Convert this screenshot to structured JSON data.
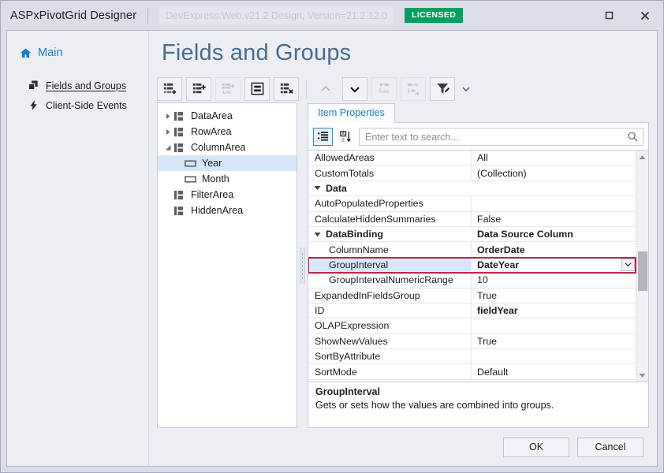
{
  "titlebar": {
    "app_title": "ASPxPivotGrid Designer",
    "assembly": "DevExpress.Web.v21.2.Design, Version=21.2.12.0",
    "license_badge": "LICENSED",
    "maximize_icon": "maximize-icon",
    "close_icon": "close-icon"
  },
  "sidebar": {
    "group_label": "Main",
    "home_icon": "home-icon",
    "items": [
      {
        "label": "Fields and Groups",
        "icon": "layers-icon",
        "active": true
      },
      {
        "label": "Client-Side Events",
        "icon": "lightning-icon",
        "active": false
      }
    ]
  },
  "page": {
    "title": "Fields and Groups"
  },
  "toolbar": {
    "buttons": [
      {
        "name": "add-field-button",
        "icon": "field-add-icon",
        "disabled": false
      },
      {
        "name": "add-group-button",
        "icon": "group-add-icon",
        "disabled": false
      },
      {
        "name": "add-child-button",
        "icon": "child-add-icon",
        "disabled": true
      },
      {
        "name": "edit-item-button",
        "icon": "edit-box-icon",
        "disabled": false
      },
      {
        "name": "delete-item-button",
        "icon": "field-delete-icon",
        "disabled": false
      },
      {
        "name": "move-up-button",
        "icon": "chevron-up-icon",
        "disabled": true
      },
      {
        "name": "move-down-button",
        "icon": "chevron-down-icon",
        "disabled": false
      },
      {
        "name": "move-out-button",
        "icon": "outdent-icon",
        "disabled": true
      },
      {
        "name": "move-in-button",
        "icon": "indent-icon",
        "disabled": true
      },
      {
        "name": "customize-button",
        "icon": "funnel-icon",
        "disabled": false
      }
    ],
    "split_arrow_icon": "caret-down-icon"
  },
  "tree": {
    "nodes": [
      {
        "label": "DataArea",
        "icon": "area-icon",
        "indent": 0,
        "expander": "collapsed",
        "selected": false
      },
      {
        "label": "RowArea",
        "icon": "area-icon",
        "indent": 0,
        "expander": "collapsed",
        "selected": false
      },
      {
        "label": "ColumnArea",
        "icon": "area-icon",
        "indent": 0,
        "expander": "expanded",
        "selected": false
      },
      {
        "label": "Year",
        "icon": "field-icon",
        "indent": 1,
        "expander": "none",
        "selected": true
      },
      {
        "label": "Month",
        "icon": "field-icon",
        "indent": 1,
        "expander": "none",
        "selected": false
      },
      {
        "label": "FilterArea",
        "icon": "area-icon",
        "indent": 0,
        "expander": "none",
        "selected": false
      },
      {
        "label": "HiddenArea",
        "icon": "area-icon",
        "indent": 0,
        "expander": "none",
        "selected": false
      }
    ]
  },
  "properties_pane": {
    "tab_label": "Item Properties",
    "categorized_icon": "categorized-view-icon",
    "sort_az_icon": "sort-alphabetical-icon",
    "search": {
      "value": "",
      "placeholder": "Enter text to search..."
    },
    "search_icon": "search-icon",
    "dropdown_icon": "chevron-down-icon",
    "scroll_up_icon": "triangle-up-icon",
    "scroll_down_icon": "triangle-down-icon",
    "rows": [
      {
        "name": "AllowedAreas",
        "value": "All",
        "type": "prop",
        "indent": 0,
        "bold": false,
        "selected": false
      },
      {
        "name": "CustomTotals",
        "value": "(Collection)",
        "type": "prop",
        "indent": 0,
        "bold": false,
        "selected": false
      },
      {
        "name": "Data",
        "value": "",
        "type": "category",
        "indent": 0,
        "bold": true,
        "selected": false,
        "expanded": true
      },
      {
        "name": "AutoPopulatedProperties",
        "value": "",
        "type": "prop",
        "indent": 0,
        "bold": false,
        "selected": false
      },
      {
        "name": "CalculateHiddenSummaries",
        "value": "False",
        "type": "prop",
        "indent": 0,
        "bold": false,
        "selected": false
      },
      {
        "name": "DataBinding",
        "value": "Data Source Column",
        "type": "category",
        "indent": 0,
        "bold": true,
        "selected": false,
        "expanded": true
      },
      {
        "name": "ColumnName",
        "value": "OrderDate",
        "type": "prop",
        "indent": 1,
        "bold": true,
        "selected": false
      },
      {
        "name": "GroupInterval",
        "value": "DateYear",
        "type": "prop",
        "indent": 1,
        "bold": true,
        "selected": true
      },
      {
        "name": "GroupIntervalNumericRange",
        "value": "10",
        "type": "prop",
        "indent": 1,
        "bold": false,
        "selected": false
      },
      {
        "name": "ExpandedInFieldsGroup",
        "value": "True",
        "type": "prop",
        "indent": 0,
        "bold": false,
        "selected": false
      },
      {
        "name": "ID",
        "value": "fieldYear",
        "type": "prop",
        "indent": 0,
        "bold": true,
        "selected": false
      },
      {
        "name": "OLAPExpression",
        "value": "",
        "type": "prop",
        "indent": 0,
        "bold": false,
        "selected": false
      },
      {
        "name": "ShowNewValues",
        "value": "True",
        "type": "prop",
        "indent": 0,
        "bold": false,
        "selected": false
      },
      {
        "name": "SortByAttribute",
        "value": "",
        "type": "prop",
        "indent": 0,
        "bold": false,
        "selected": false
      },
      {
        "name": "SortMode",
        "value": "Default",
        "type": "prop",
        "indent": 0,
        "bold": false,
        "selected": false
      }
    ]
  },
  "description": {
    "title": "GroupInterval",
    "text": "Gets or sets how the values are combined into groups."
  },
  "footer": {
    "ok_label": "OK",
    "cancel_label": "Cancel"
  },
  "colors": {
    "accent_blue": "#1a7fc1",
    "license_green": "#00a160",
    "selection_blue": "#d6e7f7",
    "selected_row_border": "#b4294a",
    "title_text": "#4a6d8c"
  }
}
